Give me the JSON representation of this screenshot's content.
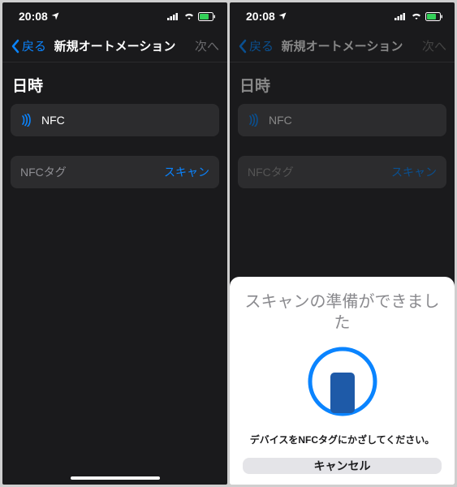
{
  "status": {
    "time": "20:08"
  },
  "nav": {
    "back": "戻る",
    "title": "新規オートメーション",
    "next": "次へ"
  },
  "section": {
    "header": "日時"
  },
  "nfc": {
    "name": "NFC",
    "tag_label": "NFCタグ",
    "scan": "スキャン"
  },
  "sheet": {
    "title": "スキャンの準備ができました",
    "message": "デバイスをNFCタグにかざしてください。",
    "cancel": "キャンセル"
  }
}
